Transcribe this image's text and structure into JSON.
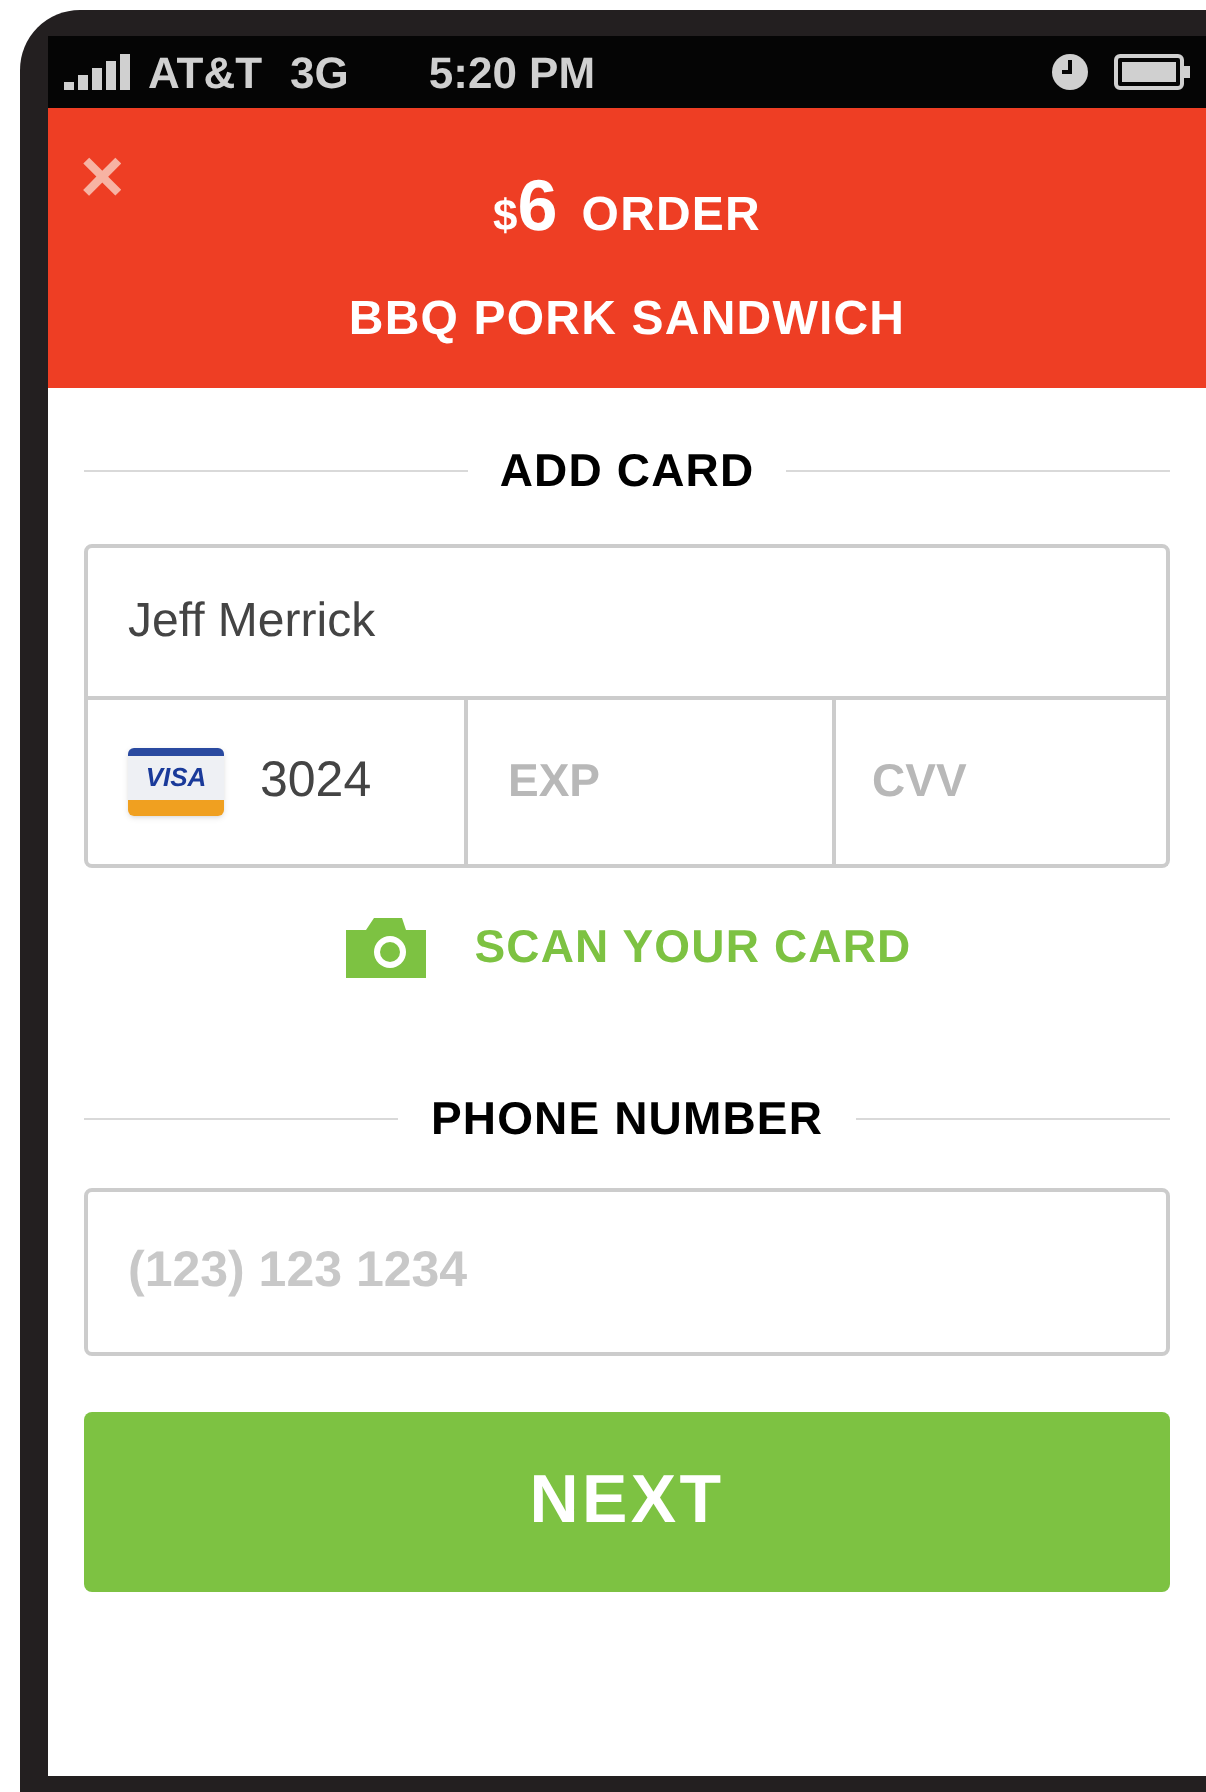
{
  "status_bar": {
    "carrier": "AT&T",
    "network": "3G",
    "time": "5:20 PM"
  },
  "header": {
    "close": "×",
    "currency": "$",
    "amount": "6",
    "label": "ORDER",
    "item": "BBQ PORK SANDWICH"
  },
  "add_card": {
    "title": "ADD CARD",
    "name_value": "Jeff Merrick",
    "card_brand": "VISA",
    "card_number": "3024",
    "exp_placeholder": "EXP",
    "cvv_placeholder": "CVV"
  },
  "scan_link": "SCAN YOUR CARD",
  "phone": {
    "title": "PHONE NUMBER",
    "placeholder": "(123) 123 1234"
  },
  "next_button": "NEXT"
}
